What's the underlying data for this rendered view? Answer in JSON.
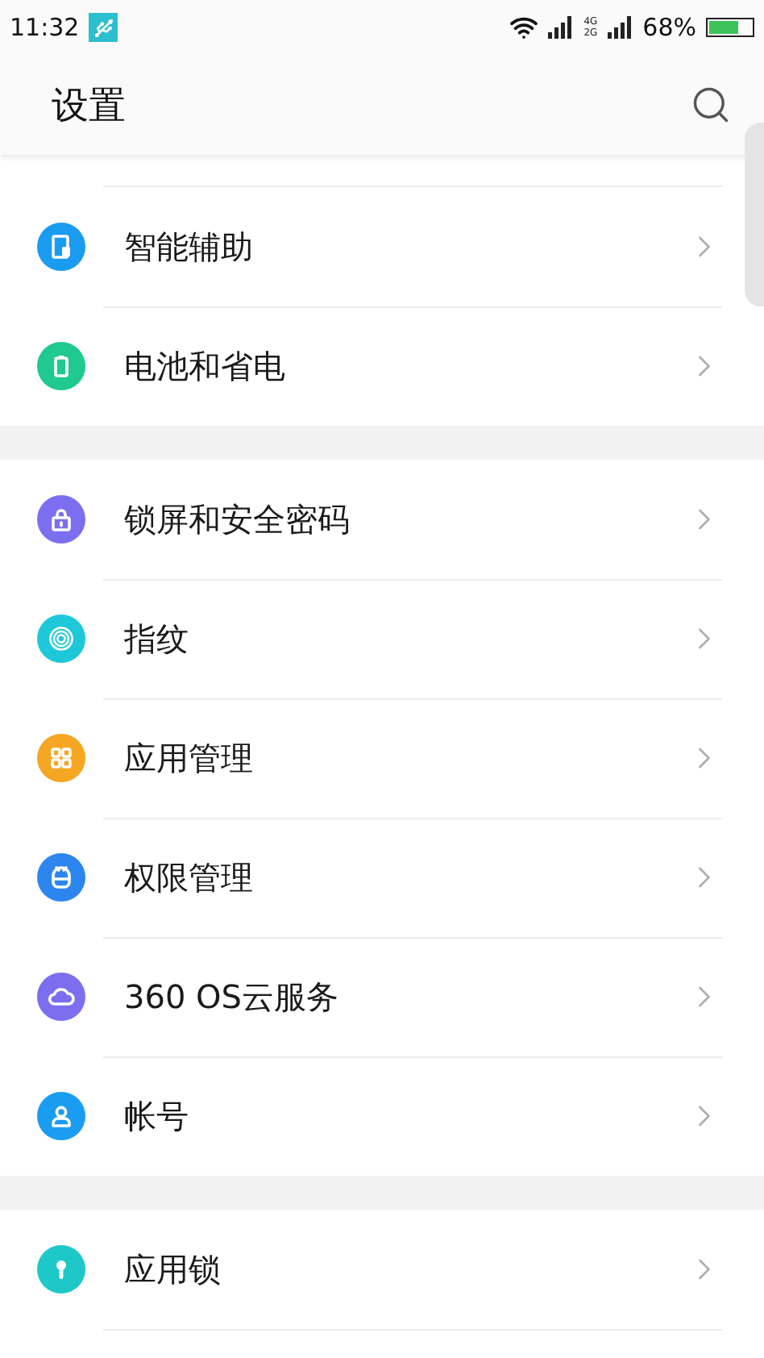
{
  "status_bar": {
    "time": "11:32",
    "network_top": "4G",
    "network_bottom": "2G",
    "battery": "68%"
  },
  "header": {
    "title": "设置"
  },
  "sections": [
    {
      "items": [
        {
          "label": "智能辅助",
          "kind": "assist",
          "color": "#1a9cf0"
        },
        {
          "label": "电池和省电",
          "kind": "power",
          "color": "#1fc98f"
        }
      ]
    },
    {
      "items": [
        {
          "label": "锁屏和安全密码",
          "kind": "security",
          "color": "#7b6ff0"
        },
        {
          "label": "指纹",
          "kind": "fingerprint",
          "color": "#1ec8d8"
        },
        {
          "label": "应用管理",
          "kind": "apps",
          "color": "#f5a623"
        },
        {
          "label": "权限管理",
          "kind": "permissions",
          "color": "#2d86f0"
        },
        {
          "label": "360 OS云服务",
          "kind": "cloud",
          "color": "#7b6ff0"
        },
        {
          "label": "帐号",
          "kind": "account",
          "color": "#1a9cf0"
        }
      ]
    },
    {
      "items": [
        {
          "label": "应用锁",
          "kind": "applock",
          "color": "#1ec8c8"
        }
      ]
    }
  ]
}
